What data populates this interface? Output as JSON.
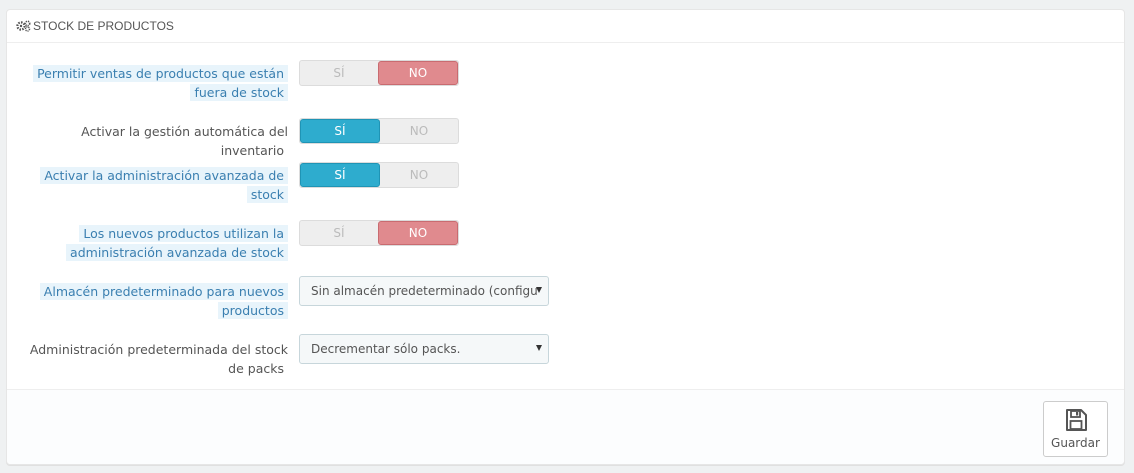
{
  "panel": {
    "title": "Stock de productos",
    "title_icon": "cogs-icon"
  },
  "fields": [
    {
      "label": "Permitir ventas de productos que están fuera de stock",
      "type": "switch",
      "yes": "SÍ",
      "no": "NO",
      "value": "no",
      "help": true
    },
    {
      "label": "Activar la gestión automática del inventario",
      "type": "switch",
      "yes": "SÍ",
      "no": "NO",
      "value": "yes",
      "help": false
    },
    {
      "label": "Activar la administración avanzada de stock",
      "type": "switch",
      "yes": "SÍ",
      "no": "NO",
      "value": "yes",
      "help": true
    },
    {
      "label": "Los nuevos productos utilizan la administración avanzada de stock",
      "type": "switch",
      "yes": "SÍ",
      "no": "NO",
      "value": "no",
      "help": true
    },
    {
      "label": "Almacén predeterminado para nuevos productos",
      "type": "select",
      "value": "Sin almacén predeterminado (configu",
      "help": true
    },
    {
      "label": "Administración predeterminada del stock de packs",
      "type": "select",
      "value": "Decrementar sólo packs.",
      "help": false
    }
  ],
  "footer": {
    "save_label": "Guardar",
    "save_icon": "floppy-disk-icon"
  },
  "colors": {
    "switch_yes": "#2eacce",
    "switch_no": "#e08a8e",
    "help_label_bg": "#e8f4fb",
    "help_label_text": "#3a7fb0"
  }
}
